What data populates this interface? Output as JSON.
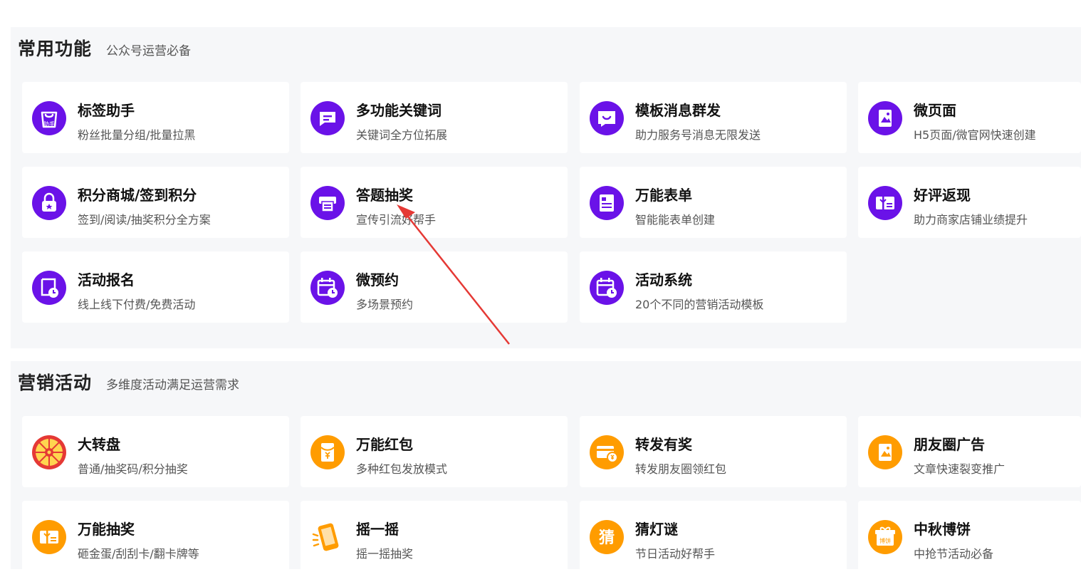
{
  "colors": {
    "purple": "#6a12e8",
    "orange": "#ff9c00",
    "arrow": "#e53935"
  },
  "sections": [
    {
      "title": "常用功能",
      "subtitle": "公众号运营必备",
      "cards": [
        {
          "title": "标签助手",
          "desc": "粉丝批量分组/批量拉黑",
          "icon": "shopping-bag-icon",
          "icon_text": "助手"
        },
        {
          "title": "多功能关键词",
          "desc": "关键词全方位拓展",
          "icon": "chat-bubble-icon"
        },
        {
          "title": "模板消息群发",
          "desc": "助力服务号消息无限发送",
          "icon": "smile-message-icon"
        },
        {
          "title": "微页面",
          "desc": "H5页面/微官网快速创建",
          "icon": "page-image-icon"
        },
        {
          "title": "积分商城/签到积分",
          "desc": "签到/阅读/抽奖积分全方案",
          "icon": "lock-bag-icon"
        },
        {
          "title": "答题抽奖",
          "desc": "宣传引流好帮手",
          "icon": "printer-icon"
        },
        {
          "title": "万能表单",
          "desc": "智能能表单创建",
          "icon": "form-icon"
        },
        {
          "title": "好评返现",
          "desc": "助力商家店铺业绩提升",
          "icon": "gift-card-icon"
        },
        {
          "title": "活动报名",
          "desc": "线上线下付费/免费活动",
          "icon": "signup-clock-icon"
        },
        {
          "title": "微预约",
          "desc": "多场景预约",
          "icon": "calendar-clock-icon"
        },
        {
          "title": "活动系统",
          "desc": "20个不同的营销活动模板",
          "icon": "calendar-clock-icon"
        }
      ]
    },
    {
      "title": "营销活动",
      "subtitle": "多维度活动满足运营需求",
      "cards": [
        {
          "title": "大转盘",
          "desc": "普通/抽奖码/积分抽奖",
          "icon": "prize-wheel-icon"
        },
        {
          "title": "万能红包",
          "desc": "多种红包发放模式",
          "icon": "red-packet-icon"
        },
        {
          "title": "转发有奖",
          "desc": "转发朋友圈领红包",
          "icon": "wallet-coin-icon"
        },
        {
          "title": "朋友圈广告",
          "desc": "文章快速裂变推广",
          "icon": "page-image-icon"
        },
        {
          "title": "万能抽奖",
          "desc": "砸金蛋/刮刮卡/翻卡牌等",
          "icon": "gift-card-icon"
        },
        {
          "title": "摇一摇",
          "desc": "摇一摇抽奖",
          "icon": "shaking-phone-icon"
        },
        {
          "title": "猜灯谜",
          "desc": "节日活动好帮手",
          "icon": "guess-icon",
          "icon_text": "猜"
        },
        {
          "title": "中秋博饼",
          "desc": "中抢节活动必备",
          "icon": "gift-box-icon",
          "icon_text": "博饼"
        }
      ]
    }
  ]
}
